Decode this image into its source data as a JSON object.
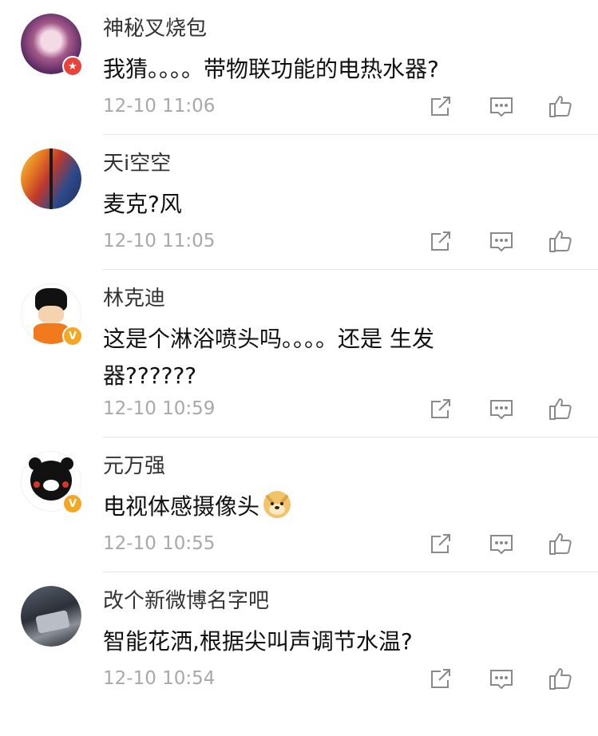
{
  "comments": [
    {
      "username": "神秘叉烧包",
      "text": "我猜。。。。带物联功能的电热水器?",
      "time": "12-10 11:06",
      "avatar": "anime-girl-avatar",
      "badge": "red-star-badge"
    },
    {
      "username": "天i空空",
      "text": "麦克?风",
      "time": "12-10 11:05",
      "avatar": "abstract-painting-avatar",
      "badge": ""
    },
    {
      "username": "林克迪",
      "text": "这是个淋浴喷头吗。。。。还是 生发器??????",
      "time": "12-10 10:59",
      "avatar": "goku-avatar",
      "badge": "gold-v-badge"
    },
    {
      "username": "元万强",
      "text": "电视体感摄像头",
      "time": "12-10 10:55",
      "avatar": "kumamon-avatar",
      "badge": "gold-v-badge",
      "emoji": "doge-emoji"
    },
    {
      "username": "改个新微博名字吧",
      "text": "智能花洒,根据尖叫声调节水温?",
      "time": "12-10 10:54",
      "avatar": "car-interior-avatar",
      "badge": ""
    }
  ],
  "badge_text": {
    "red": "★",
    "gold": "V"
  },
  "icons": {
    "share": "share-icon",
    "reply": "comment-icon",
    "like": "thumbs-up-icon"
  },
  "colors": {
    "text": "#111111",
    "username": "#333333",
    "time": "#a8a8a8",
    "icon": "#8a8a8a",
    "divider": "#e6e6e6"
  }
}
